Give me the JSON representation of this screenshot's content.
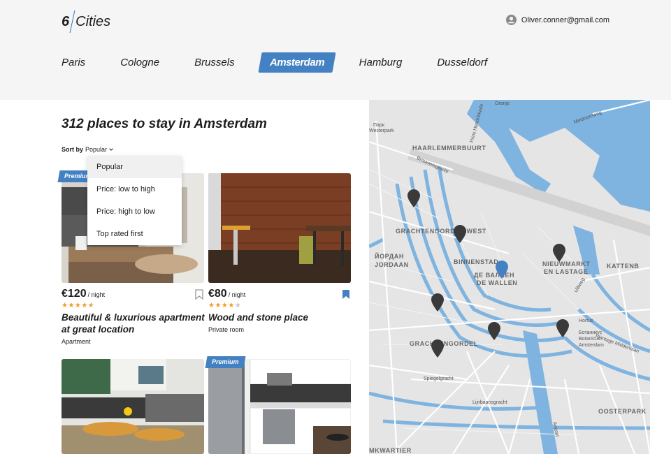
{
  "header": {
    "logo_number": "6",
    "logo_text": "Cities",
    "user_email": "Oliver.conner@gmail.com"
  },
  "tabs": [
    {
      "label": "Paris",
      "active": false
    },
    {
      "label": "Cologne",
      "active": false
    },
    {
      "label": "Brussels",
      "active": false
    },
    {
      "label": "Amsterdam",
      "active": true
    },
    {
      "label": "Hamburg",
      "active": false
    },
    {
      "label": "Dusseldorf",
      "active": false
    }
  ],
  "main": {
    "title": "312 places to stay in Amsterdam",
    "sort_label": "Sort by",
    "sort_value": "Popular",
    "sort_options": [
      "Popular",
      "Price: low to high",
      "Price: high to low",
      "Top rated first"
    ]
  },
  "cards": [
    {
      "premium": "Premium",
      "price": "€120",
      "price_suffix": "/ night",
      "rating": 4.5,
      "title": "Beautiful & luxurious apartment at great location",
      "type": "Apartment",
      "bookmarked": false
    },
    {
      "premium": "",
      "price": "€80",
      "price_suffix": "/ night",
      "rating": 4,
      "title": "Wood and stone place",
      "type": "Private room",
      "bookmarked": true
    },
    {
      "premium": "",
      "price": "",
      "price_suffix": "",
      "rating": 0,
      "title": "",
      "type": "",
      "bookmarked": false
    },
    {
      "premium": "Premium",
      "price": "",
      "price_suffix": "",
      "rating": 0,
      "title": "",
      "type": "",
      "bookmarked": false
    }
  ],
  "map": {
    "labels": [
      "HAARLEMMERBUURT",
      "GRACHTENGORDEL-WEST",
      "ЙОРДАН",
      "JORDAAN",
      "BINNENSTAD",
      "ДЕ ВАЛЛЕН",
      "DE WALLEN",
      "NIEUWMARKT",
      "EN LASTAGE",
      "KATTENB",
      "GRACHTENGORDEL",
      "OOSTERPARK",
      "MKWARTIER"
    ],
    "small_labels": [
      "Парк",
      "Westerpark",
      "Brouwersgracht",
      "Prins Hendrikkade",
      "Meidoornweg",
      "Spiegelgracht",
      "Lijnbaansgracht",
      "Plantage Middenlaan",
      "Hortus",
      "Ботаникус",
      "Botanicus",
      "Amsterdam",
      "Amstel",
      "Uiltweg",
      "Oranje"
    ]
  },
  "colors": {
    "accent": "#4481c3",
    "star": "#f59a23",
    "water": "#7fb3e0",
    "pin": "#3a3a3a",
    "pin_active": "#4481c3"
  }
}
